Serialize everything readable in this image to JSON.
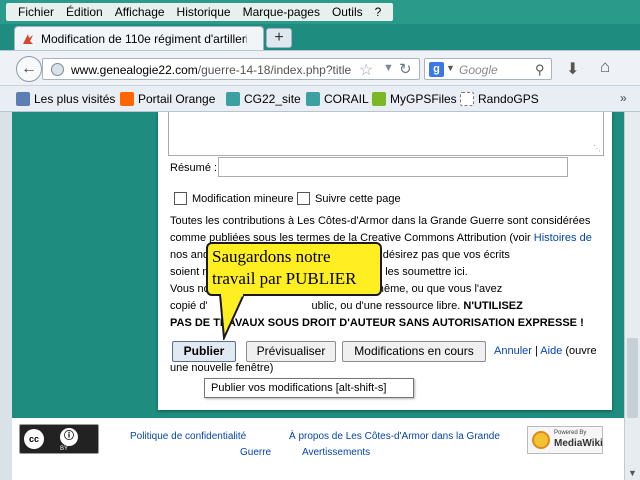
{
  "menubar": {
    "items": [
      "Fichier",
      "Édition",
      "Affichage",
      "Historique",
      "Marque-pages",
      "Outils",
      "?"
    ]
  },
  "tabs": {
    "active_title": "Modification de 110e régiment d'artilleri...",
    "new_tab_label": "+"
  },
  "navbar": {
    "url_domain": "www.genealogie22.com",
    "url_path": "/guerre-14-18/index.php?title",
    "search_placeholder": "Google"
  },
  "bookmarks": {
    "items": [
      {
        "label": "Les plus visités",
        "icon": "pages-icon",
        "color": "#5b7fb5"
      },
      {
        "label": "Portail Orange",
        "icon": "orange-icon",
        "color": "#ff6600"
      },
      {
        "label": "CG22_site",
        "icon": "cg22-icon",
        "color": "#3aa0a0"
      },
      {
        "label": "CORAIL",
        "icon": "corail-icon",
        "color": "#3aa0a0"
      },
      {
        "label": "MyGPSFiles",
        "icon": "mygps-icon",
        "color": "#7ab828"
      },
      {
        "label": "RandoGPS",
        "icon": "page-icon",
        "color": "#ffffff"
      }
    ],
    "more": "»"
  },
  "editform": {
    "summary_label": "Résumé :",
    "minor_edit_label": "Modification mineure",
    "watch_label": "Suivre cette page",
    "disclaimer_lines": [
      "Toutes les contributions à Les Côtes-d'Armor dans la Grande Guerre sont considérées",
      "comme publiées sous les termes de la Creative Commons Attribution (voir ",
      "nos and                                  s). Si vous ne désirez pas que vos écrits",
      "soient m                                        de ne pas les soumettre ici.",
      "Vous no                              écrit ceci vous-même, ou que vous l'avez",
      "copié d'                                  ublic, ou d'une ressource libre. ",
      "PAS DE TRAVAUX SOUS DROIT D'AUTEUR SANS AUTORISATION EXPRESSE !"
    ],
    "disclaimer_link": "Histoires de",
    "disclaimer_bold": "N'UTILISEZ",
    "publish_button": "Publier",
    "preview_button": "Prévisualiser",
    "changes_button": "Modifications en cours",
    "cancel_link": "Annuler",
    "separator": "|",
    "help_link": "Aide",
    "help_suffix_1": " (ouvre",
    "help_suffix_2": "une nouvelle fenêtre)",
    "tooltip": "Publier vos modifications [alt-shift-s]"
  },
  "callout": {
    "text": "Saugardons notre travail par PUBLIER",
    "color": "#ffee22"
  },
  "footer": {
    "privacy_link": "Politique de confidentialité",
    "about_link_1": "À propos de Les Côtes-d'Armor dans la Grande",
    "about_link_2": "Guerre",
    "disclaimers_link": "Avertissements",
    "cc_by": "BY",
    "mediawiki_powered": "Powered By",
    "mediawiki_name": "MediaWiki"
  },
  "colors": {
    "background": "#1e8c7e",
    "link": "#0645ad"
  }
}
